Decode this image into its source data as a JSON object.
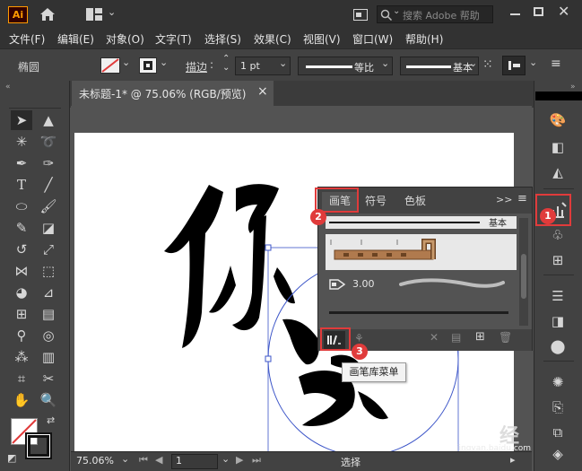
{
  "app": {
    "logo": "Ai"
  },
  "titlebar": {
    "search_placeholder": "搜索 Adobe 帮助"
  },
  "menu": [
    "文件(F)",
    "编辑(E)",
    "对象(O)",
    "文字(T)",
    "选择(S)",
    "效果(C)",
    "视图(V)",
    "窗口(W)",
    "帮助(H)"
  ],
  "control": {
    "object_label": "椭圆",
    "stroke_label": "描边",
    "stroke_weight": "1 pt",
    "profile_label": "等比",
    "brush_label": "基本"
  },
  "document": {
    "tab_title": "未标题-1* @ 75.06% (RGB/预览)",
    "close": "×"
  },
  "brush_panel": {
    "tabs": [
      "画笔",
      "符号",
      "色板"
    ],
    "selected_brush": "基本",
    "size_label": "3.00",
    "menu_more": ">>",
    "library_menu_tooltip": "画笔库菜单"
  },
  "annotations": [
    "1",
    "2",
    "3"
  ],
  "status": {
    "zoom": "75.06%",
    "page": "1",
    "mode": "选择"
  },
  "watermark": {
    "text": "经验",
    "site": "jingyan.baidu.com"
  },
  "colors": {
    "accent": "#e03b3b",
    "selection": "#3c55c8",
    "panel_bg": "#535353",
    "chrome": "#323232"
  }
}
